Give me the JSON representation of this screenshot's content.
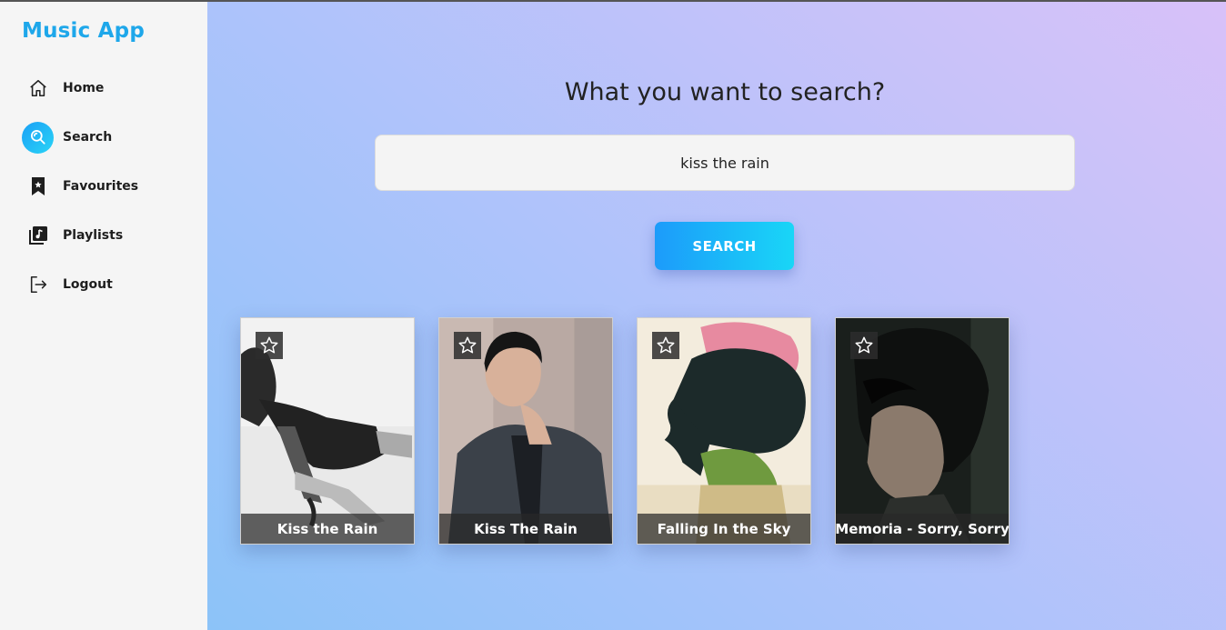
{
  "sidebar": {
    "brand": "Music App",
    "items": [
      {
        "label": "Home",
        "icon": "home-icon",
        "active": false
      },
      {
        "label": "Search",
        "icon": "search-icon",
        "active": true
      },
      {
        "label": "Favourites",
        "icon": "bookmark-star-icon",
        "active": false
      },
      {
        "label": "Playlists",
        "icon": "playlist-icon",
        "active": false
      },
      {
        "label": "Logout",
        "icon": "logout-icon",
        "active": false
      }
    ]
  },
  "main": {
    "heading": "What you want to search?",
    "search": {
      "value": "kiss the rain",
      "placeholder": ""
    },
    "search_button": "SEARCH",
    "results": [
      {
        "title": "Kiss the Rain"
      },
      {
        "title": "Kiss The Rain"
      },
      {
        "title": "Falling In the Sky"
      },
      {
        "title": "Memoria - Sorry, Sorry"
      }
    ]
  },
  "colors": {
    "accent": "#1ea7ea",
    "button_start": "#1c9bfa",
    "button_end": "#19d6f7"
  }
}
